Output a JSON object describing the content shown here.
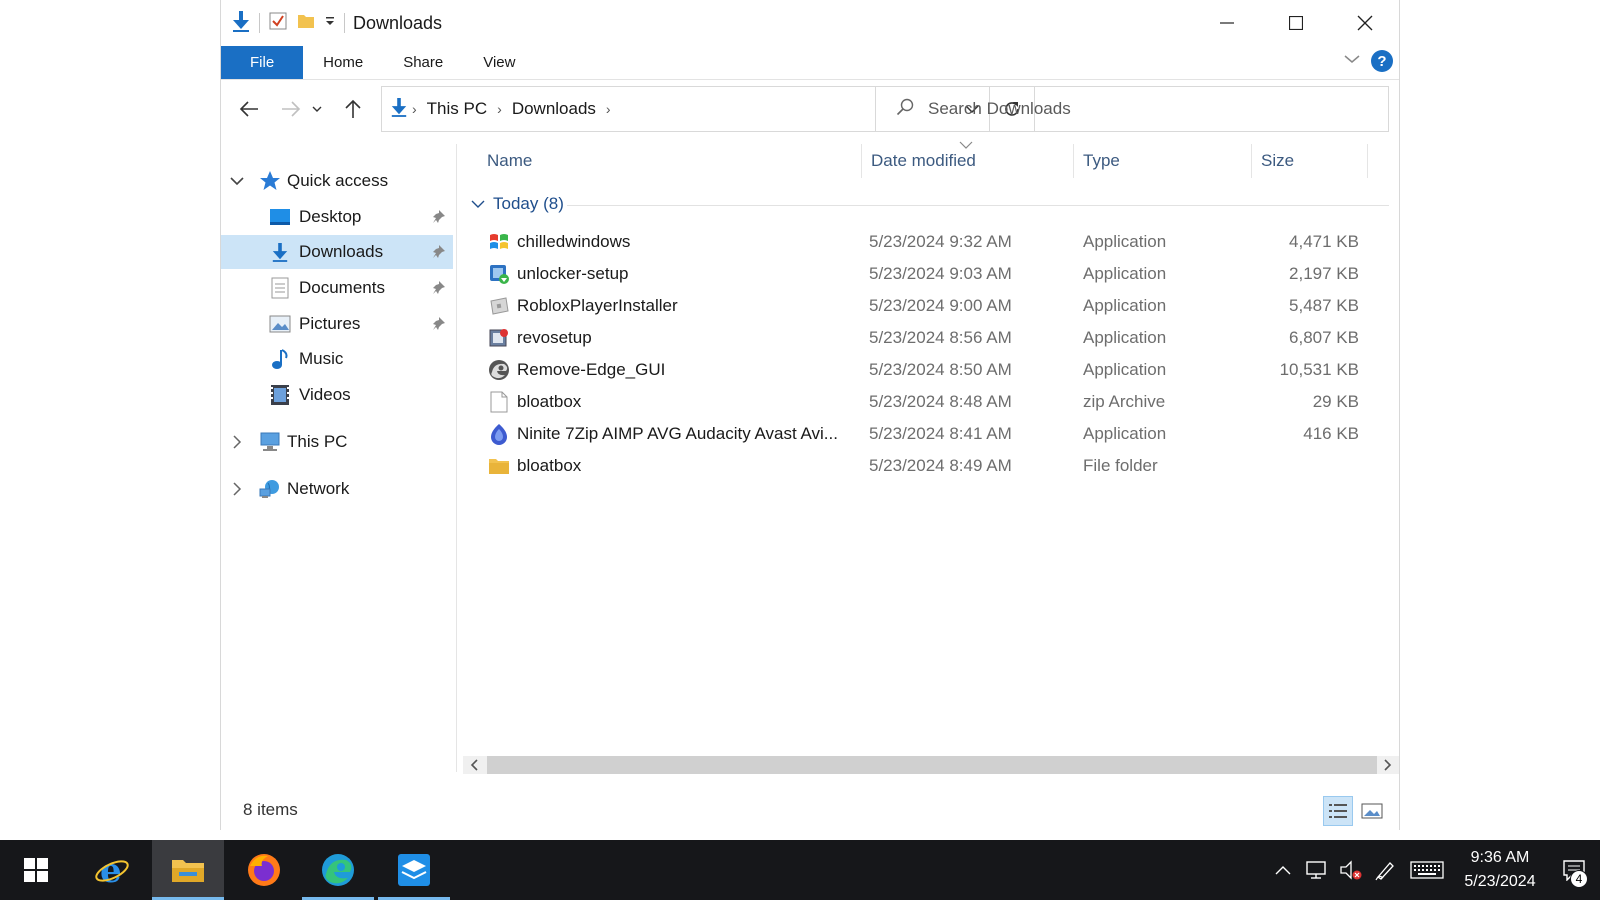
{
  "window": {
    "title": "Downloads",
    "tabs": [
      "File",
      "Home",
      "Share",
      "View"
    ]
  },
  "address": {
    "crumbs": [
      "This PC",
      "Downloads"
    ]
  },
  "search": {
    "placeholder": "Search Downloads"
  },
  "sidebar": {
    "quick_access": "Quick access",
    "items": [
      {
        "label": "Desktop",
        "icon": "desktop-icon",
        "pinned": true
      },
      {
        "label": "Downloads",
        "icon": "downloads-icon",
        "pinned": true,
        "selected": true
      },
      {
        "label": "Documents",
        "icon": "documents-icon",
        "pinned": true
      },
      {
        "label": "Pictures",
        "icon": "pictures-icon",
        "pinned": true
      },
      {
        "label": "Music",
        "icon": "music-icon",
        "pinned": false
      },
      {
        "label": "Videos",
        "icon": "videos-icon",
        "pinned": false
      }
    ],
    "this_pc": "This PC",
    "network": "Network"
  },
  "columns": {
    "name": "Name",
    "date": "Date modified",
    "type": "Type",
    "size": "Size"
  },
  "group": {
    "label": "Today (8)"
  },
  "files": [
    {
      "name": "chilledwindows",
      "date": "5/23/2024 9:32 AM",
      "type": "Application",
      "size": "4,471 KB",
      "icon": "windows-logo-icon"
    },
    {
      "name": "unlocker-setup",
      "date": "5/23/2024 9:03 AM",
      "type": "Application",
      "size": "2,197 KB",
      "icon": "installer-icon"
    },
    {
      "name": "RobloxPlayerInstaller",
      "date": "5/23/2024 9:00 AM",
      "type": "Application",
      "size": "5,487 KB",
      "icon": "roblox-icon"
    },
    {
      "name": "revosetup",
      "date": "5/23/2024 8:56 AM",
      "type": "Application",
      "size": "6,807 KB",
      "icon": "revo-icon"
    },
    {
      "name": "Remove-Edge_GUI",
      "date": "5/23/2024 8:50 AM",
      "type": "Application",
      "size": "10,531 KB",
      "icon": "edge-icon"
    },
    {
      "name": "bloatbox",
      "date": "5/23/2024 8:48 AM",
      "type": "zip Archive",
      "size": "29 KB",
      "icon": "file-icon"
    },
    {
      "name": "Ninite 7Zip AIMP AVG Audacity Avast Avi...",
      "date": "5/23/2024 8:41 AM",
      "type": "Application",
      "size": "416 KB",
      "icon": "ninite-icon"
    },
    {
      "name": "bloatbox",
      "date": "5/23/2024 8:49 AM",
      "type": "File folder",
      "size": "",
      "icon": "folder-icon"
    }
  ],
  "status": {
    "count": "8 items"
  },
  "taskbar": {
    "time": "9:36 AM",
    "date": "5/23/2024",
    "notification_count": "4"
  },
  "colors": {
    "accent": "#1a6fc4",
    "selection": "#cce4f7",
    "taskbar": "#16171a"
  }
}
